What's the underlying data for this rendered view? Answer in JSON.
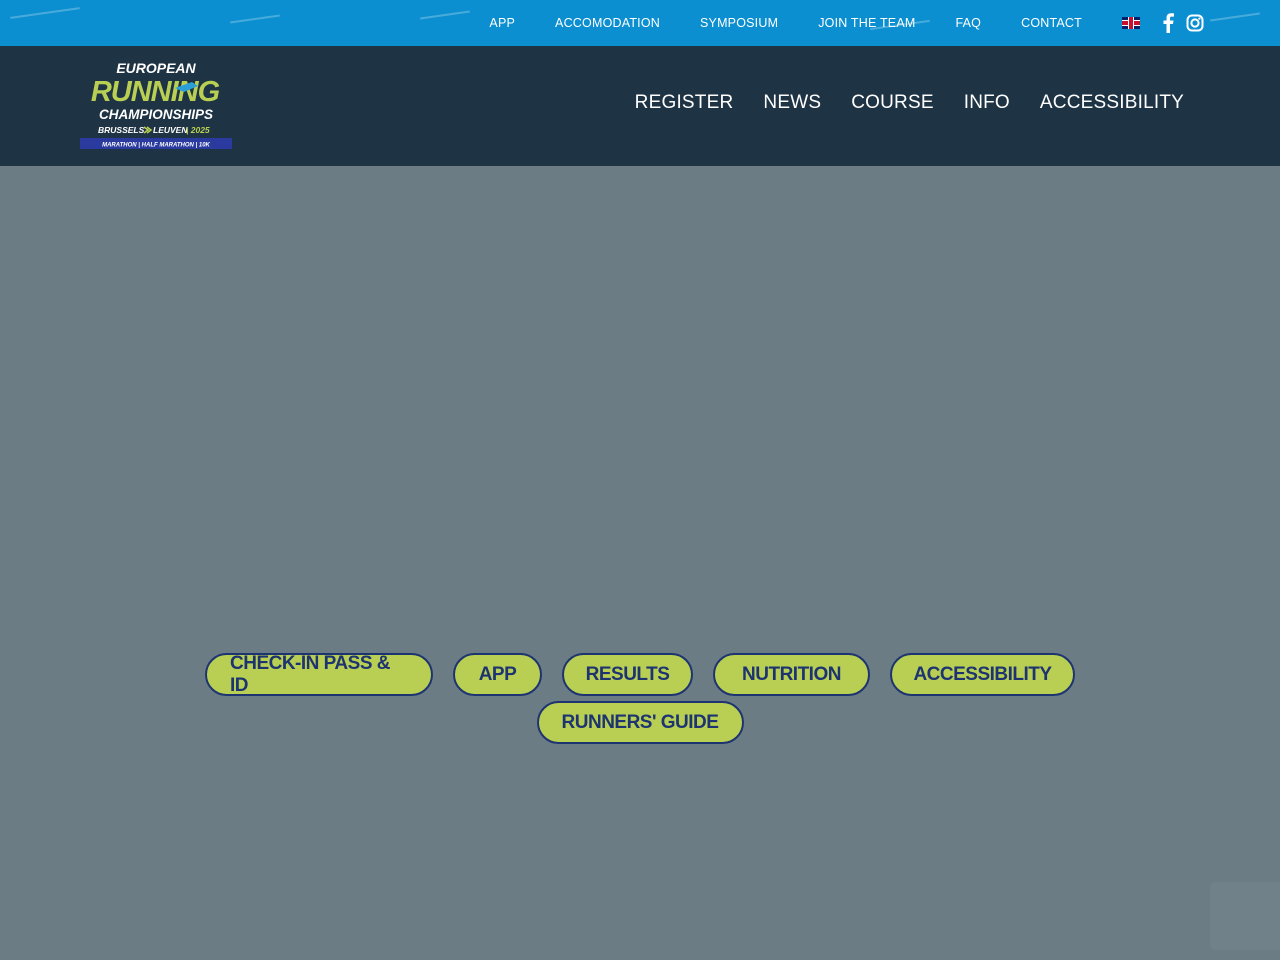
{
  "topnav": {
    "items": [
      "APP",
      "ACCOMODATION",
      "SYMPOSIUM",
      "JOIN THE TEAM",
      "FAQ",
      "CONTACT"
    ],
    "language_icon": "uk-flag-icon",
    "social_icons": [
      "facebook-icon",
      "instagram-icon"
    ]
  },
  "logo": {
    "line1": "EUROPEAN",
    "line2": "RUNNING",
    "line3": "CHAMPIONSHIPS",
    "line4_a": "BRUSSELS",
    "line4_b": "LEUVEN",
    "line4_c": "| 2025",
    "line5": "MARATHON | HALF MARATHON | 10K"
  },
  "mainnav": {
    "items": [
      "REGISTER",
      "NEWS",
      "COURSE",
      "INFO",
      "ACCESSIBILITY"
    ]
  },
  "buttons": {
    "row1": [
      "CHECK-IN PASS & ID",
      "APP",
      "RESULTS",
      "NUTRITION",
      "ACCESSIBILITY"
    ],
    "row2": [
      "RUNNERS' GUIDE"
    ]
  },
  "colors": {
    "topbar": "#0b8fd0",
    "mainbar": "#1e3344",
    "content_overlay": "#6b7c85",
    "pill_bg": "#b9cf53",
    "pill_text": "#1d3470"
  }
}
